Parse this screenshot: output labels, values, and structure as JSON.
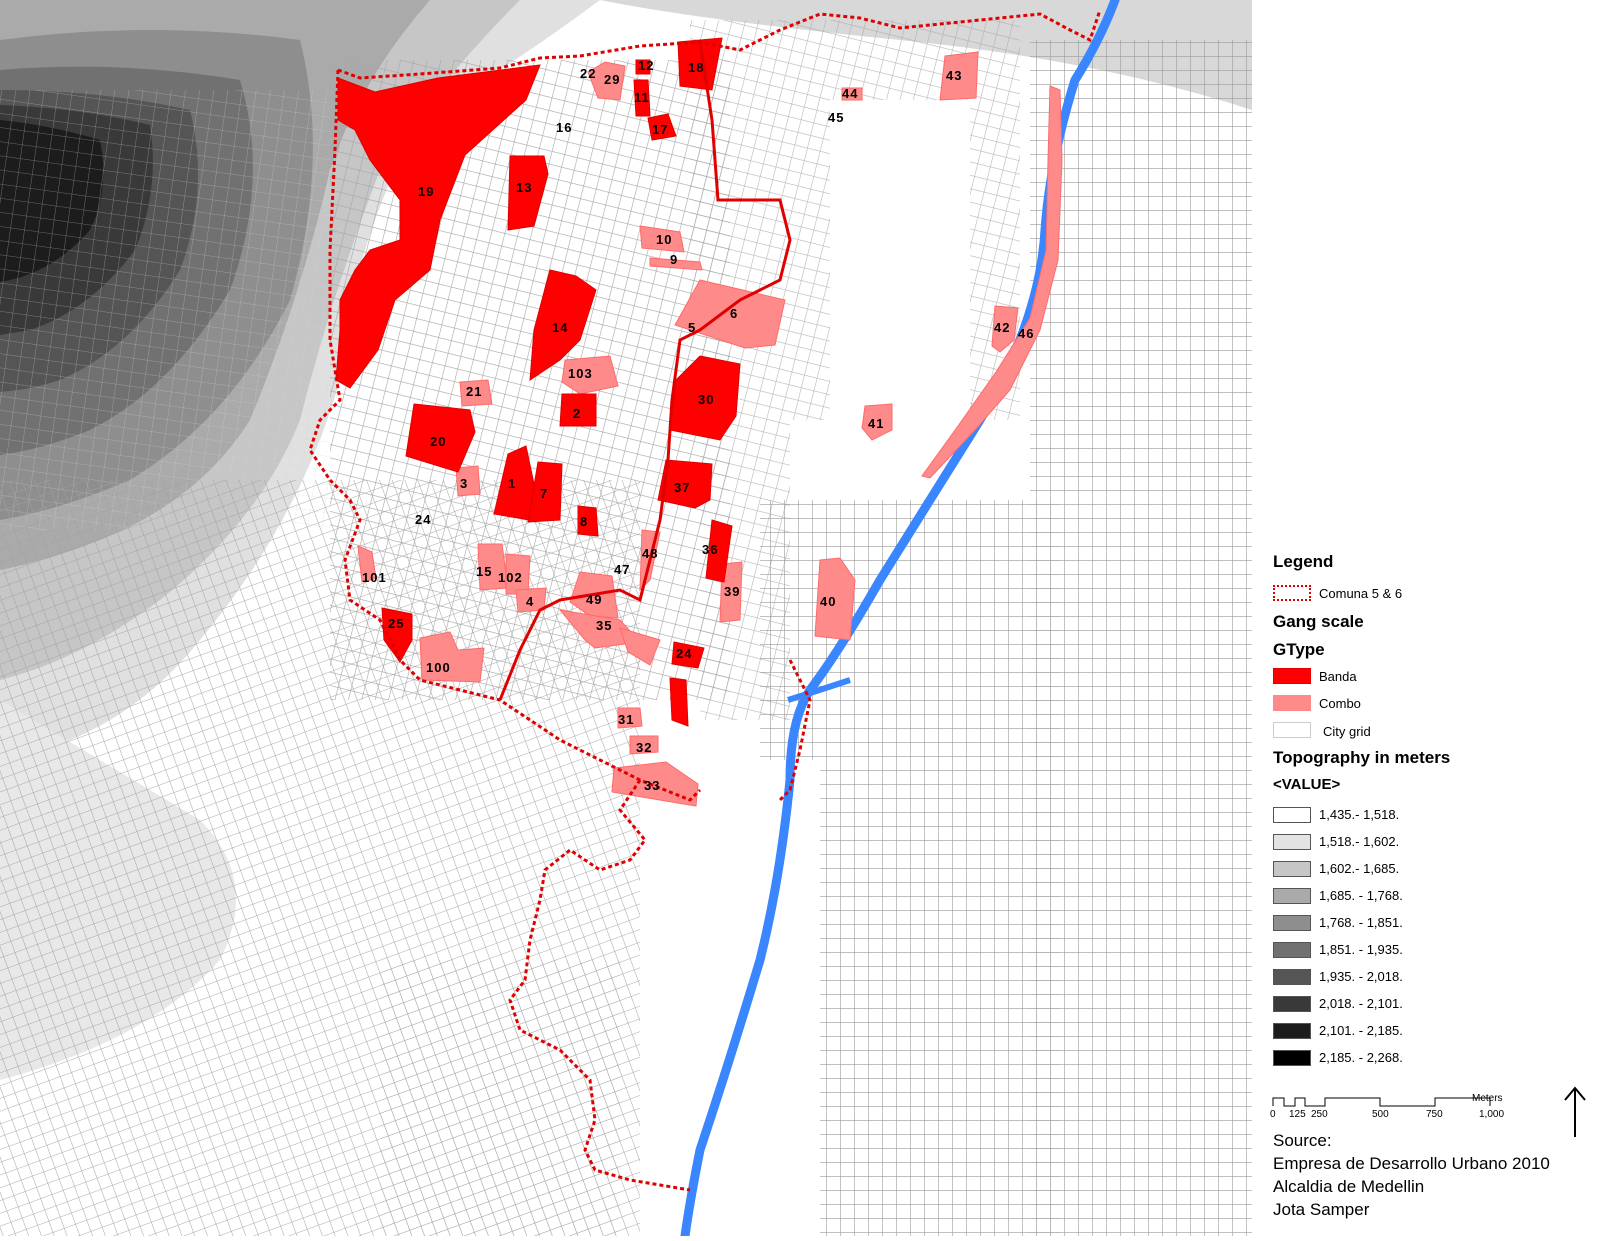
{
  "legend": {
    "title": "Legend",
    "boundary_label": "Comuna 5 & 6",
    "gang_scale_label": "Gang scale",
    "gtype_label": "GType",
    "gtype_items": [
      {
        "label": "Banda",
        "color": "#ff0000"
      },
      {
        "label": "Combo",
        "color": "#ff8a8a"
      },
      {
        "label": "City grid",
        "color": "#ffffff"
      }
    ],
    "topography_title": "Topography in meters",
    "value_label": "<VALUE>",
    "topography_classes": [
      {
        "label": "1,435.- 1,518.",
        "color": "#ffffff"
      },
      {
        "label": "1,518.- 1,602.",
        "color": "#e3e3e3"
      },
      {
        "label": "1,602.- 1,685.",
        "color": "#c6c6c6"
      },
      {
        "label": "1,685. - 1,768.",
        "color": "#aaaaaa"
      },
      {
        "label": "1,768. - 1,851.",
        "color": "#8e8e8e"
      },
      {
        "label": "1,851. - 1,935.",
        "color": "#717171"
      },
      {
        "label": "1,935. - 2,018.",
        "color": "#555555"
      },
      {
        "label": "2,018. - 2,101.",
        "color": "#393939"
      },
      {
        "label": "2,101. - 2,185.",
        "color": "#1c1c1c"
      },
      {
        "label": "2,185. - 2,268.",
        "color": "#000000"
      }
    ],
    "scale_bar": {
      "unit": "Meters",
      "ticks": [
        "0",
        "125",
        "250",
        "500",
        "750",
        "1,000"
      ]
    },
    "source": [
      "Source:",
      "Empresa de Desarrollo Urbano 2010",
      "Alcaldia de Medellin",
      "Jota Samper"
    ]
  },
  "map": {
    "colors": {
      "banda": "#ff0000",
      "combo": "#ff8a8a",
      "boundary": "#e00000",
      "river": "#3a86ff"
    },
    "zones": [
      {
        "id": "19",
        "type": "Banda"
      },
      {
        "id": "18",
        "type": "Banda"
      },
      {
        "id": "13",
        "type": "Banda"
      },
      {
        "id": "14",
        "type": "Banda"
      },
      {
        "id": "20",
        "type": "Banda"
      },
      {
        "id": "30",
        "type": "Banda"
      },
      {
        "id": "37",
        "type": "Banda"
      },
      {
        "id": "1",
        "type": "Banda"
      },
      {
        "id": "7",
        "type": "Banda"
      },
      {
        "id": "8",
        "type": "Banda"
      },
      {
        "id": "2",
        "type": "Banda"
      },
      {
        "id": "36",
        "type": "Banda"
      },
      {
        "id": "25",
        "type": "Banda"
      },
      {
        "id": "24",
        "type": "Banda"
      },
      {
        "id": "17",
        "type": "Banda"
      },
      {
        "id": "11",
        "type": "Banda"
      },
      {
        "id": "12",
        "type": "Banda"
      },
      {
        "id": "29",
        "type": "Combo"
      },
      {
        "id": "43",
        "type": "Combo"
      },
      {
        "id": "44",
        "type": "Combo"
      },
      {
        "id": "10",
        "type": "Combo"
      },
      {
        "id": "9",
        "type": "Combo"
      },
      {
        "id": "6",
        "type": "Combo"
      },
      {
        "id": "5",
        "type": "Combo"
      },
      {
        "id": "103",
        "type": "Combo"
      },
      {
        "id": "21",
        "type": "Combo"
      },
      {
        "id": "3",
        "type": "Combo"
      },
      {
        "id": "42",
        "type": "Combo"
      },
      {
        "id": "46",
        "type": "Combo"
      },
      {
        "id": "41",
        "type": "Combo"
      },
      {
        "id": "40",
        "type": "Combo"
      },
      {
        "id": "39",
        "type": "Combo"
      },
      {
        "id": "48",
        "type": "Combo"
      },
      {
        "id": "47",
        "type": "Combo"
      },
      {
        "id": "49",
        "type": "Combo"
      },
      {
        "id": "35",
        "type": "Combo"
      },
      {
        "id": "15",
        "type": "Combo"
      },
      {
        "id": "102",
        "type": "Combo"
      },
      {
        "id": "4",
        "type": "Combo"
      },
      {
        "id": "101",
        "type": "Combo"
      },
      {
        "id": "100",
        "type": "Combo"
      },
      {
        "id": "31",
        "type": "Combo"
      },
      {
        "id": "32",
        "type": "Combo"
      },
      {
        "id": "33",
        "type": "Combo"
      },
      {
        "id": "22",
        "type": "City grid"
      },
      {
        "id": "16",
        "type": "City grid"
      },
      {
        "id": "45",
        "type": "City grid"
      },
      {
        "id": "24",
        "type": "City grid"
      }
    ]
  }
}
